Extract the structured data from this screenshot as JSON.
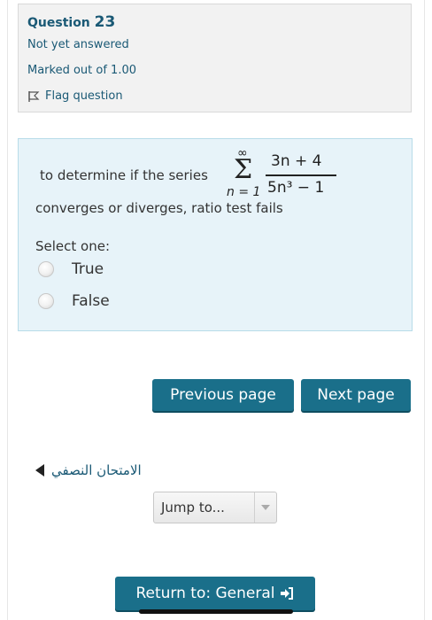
{
  "question": {
    "label": "Question",
    "number": "23",
    "status": "Not yet answered",
    "marks": "Marked out of 1.00",
    "flag_label": "Flag question"
  },
  "content": {
    "text_before": "to determine if the series",
    "formula": {
      "sigma": "Σ",
      "upper": "∞",
      "lower": "n = 1",
      "numerator": "3n + 4",
      "denominator": "5n³ − 1"
    },
    "text_after": "converges or diverges,  ratio test fails",
    "select_label": "Select one:",
    "options": [
      {
        "label": "True"
      },
      {
        "label": "False"
      }
    ]
  },
  "navigation": {
    "previous_label": "Previous page",
    "next_label": "Next page",
    "back_link": "الامتحان النصفي",
    "jump_label": "Jump to...",
    "return_label": "Return to: General"
  }
}
